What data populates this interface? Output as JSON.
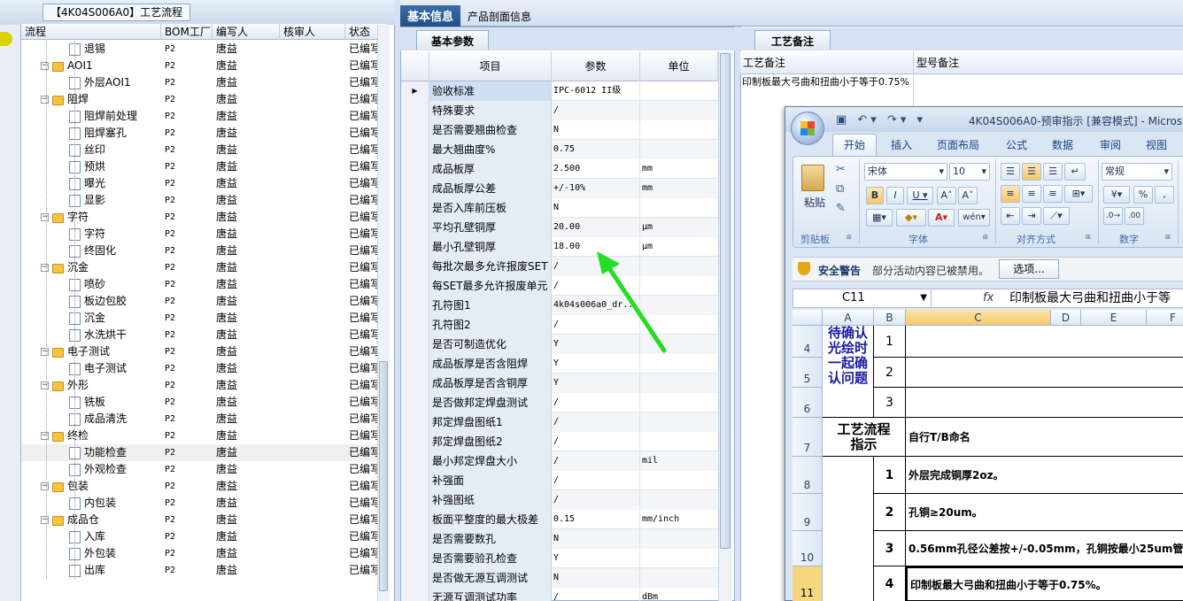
{
  "left_panel": {
    "title": "【4K04S006A0】工艺流程",
    "columns": [
      "流程",
      "BOM工厂",
      "编写人",
      "核审人",
      "状态"
    ],
    "rows": [
      {
        "name": "退锡",
        "type": "doc",
        "level": 1,
        "bom": "P2",
        "writer": "唐益",
        "status": "已编写"
      },
      {
        "name": "AOI1",
        "type": "folder",
        "level": 0,
        "bom": "P2",
        "writer": "唐益",
        "status": "已编写"
      },
      {
        "name": "外层AOI1",
        "type": "doc",
        "level": 1,
        "bom": "P2",
        "writer": "唐益",
        "status": "已编写"
      },
      {
        "name": "阻焊",
        "type": "folder",
        "level": 0,
        "bom": "P2",
        "writer": "唐益",
        "status": "已编写"
      },
      {
        "name": "阻焊前处理",
        "type": "doc",
        "level": 1,
        "bom": "P2",
        "writer": "唐益",
        "status": "已编写"
      },
      {
        "name": "阻焊塞孔",
        "type": "doc",
        "level": 1,
        "bom": "P2",
        "writer": "唐益",
        "status": "已编写"
      },
      {
        "name": "丝印",
        "type": "doc",
        "level": 1,
        "bom": "P2",
        "writer": "唐益",
        "status": "已编写"
      },
      {
        "name": "预烘",
        "type": "doc",
        "level": 1,
        "bom": "P2",
        "writer": "唐益",
        "status": "已编写"
      },
      {
        "name": "曝光",
        "type": "doc",
        "level": 1,
        "bom": "P2",
        "writer": "唐益",
        "status": "已编写"
      },
      {
        "name": "显影",
        "type": "doc",
        "level": 1,
        "bom": "P2",
        "writer": "唐益",
        "status": "已编写"
      },
      {
        "name": "字符",
        "type": "folder",
        "level": 0,
        "bom": "P2",
        "writer": "唐益",
        "status": "已编写"
      },
      {
        "name": "字符",
        "type": "doc",
        "level": 1,
        "bom": "P2",
        "writer": "唐益",
        "status": "已编写"
      },
      {
        "name": "终固化",
        "type": "doc",
        "level": 1,
        "bom": "P2",
        "writer": "唐益",
        "status": "已编写"
      },
      {
        "name": "沉金",
        "type": "folder",
        "level": 0,
        "bom": "P2",
        "writer": "唐益",
        "status": "已编写"
      },
      {
        "name": "喷砂",
        "type": "doc",
        "level": 1,
        "bom": "P2",
        "writer": "唐益",
        "status": "已编写"
      },
      {
        "name": "板边包胶",
        "type": "doc",
        "level": 1,
        "bom": "P2",
        "writer": "唐益",
        "status": "已编写"
      },
      {
        "name": "沉金",
        "type": "doc",
        "level": 1,
        "bom": "P2",
        "writer": "唐益",
        "status": "已编写"
      },
      {
        "name": "水洗烘干",
        "type": "doc",
        "level": 1,
        "bom": "P2",
        "writer": "唐益",
        "status": "已编写"
      },
      {
        "name": "电子测试",
        "type": "folder",
        "level": 0,
        "bom": "P2",
        "writer": "唐益",
        "status": "已编写"
      },
      {
        "name": "电子测试",
        "type": "doc",
        "level": 1,
        "bom": "P2",
        "writer": "唐益",
        "status": "已编写"
      },
      {
        "name": "外形",
        "type": "folder",
        "level": 0,
        "bom": "P2",
        "writer": "唐益",
        "status": "已编写"
      },
      {
        "name": "铣板",
        "type": "doc",
        "level": 1,
        "bom": "P2",
        "writer": "唐益",
        "status": "已编写"
      },
      {
        "name": "成品清洗",
        "type": "doc",
        "level": 1,
        "bom": "P2",
        "writer": "唐益",
        "status": "已编写"
      },
      {
        "name": "终检",
        "type": "folder",
        "level": 0,
        "bom": "P2",
        "writer": "唐益",
        "status": "已编写"
      },
      {
        "name": "功能检查",
        "type": "doc",
        "level": 1,
        "bom": "P2",
        "writer": "唐益",
        "status": "已编写",
        "selected": true
      },
      {
        "name": "外观检查",
        "type": "doc",
        "level": 1,
        "bom": "P2",
        "writer": "唐益",
        "status": "已编写"
      },
      {
        "name": "包装",
        "type": "folder",
        "level": 0,
        "bom": "P2",
        "writer": "唐益",
        "status": "已编写"
      },
      {
        "name": "内包装",
        "type": "doc",
        "level": 1,
        "bom": "P2",
        "writer": "唐益",
        "status": "已编写"
      },
      {
        "name": "成品仓",
        "type": "folder",
        "level": 0,
        "bom": "P2",
        "writer": "唐益",
        "status": "已编写"
      },
      {
        "name": "入库",
        "type": "doc",
        "level": 1,
        "bom": "P2",
        "writer": "唐益",
        "status": "已编写"
      },
      {
        "name": "外包装",
        "type": "doc",
        "level": 1,
        "bom": "P2",
        "writer": "唐益",
        "status": "已编写"
      },
      {
        "name": "出库",
        "type": "doc",
        "level": 1,
        "bom": "P2",
        "writer": "唐益",
        "status": "已编写"
      }
    ]
  },
  "top_tabs": {
    "active": "基本信息",
    "other": "产品剖面信息"
  },
  "basic_params": {
    "tab": "基本参数",
    "columns": [
      "项目",
      "参数",
      "单位"
    ],
    "rows": [
      {
        "item": "验收标准",
        "value": "IPC-6012 II级",
        "unit": ""
      },
      {
        "item": "特殊要求",
        "value": "/",
        "unit": ""
      },
      {
        "item": "是否需要翘曲检查",
        "value": "N",
        "unit": ""
      },
      {
        "item": "最大翘曲度%",
        "value": "0.75",
        "unit": ""
      },
      {
        "item": "成品板厚",
        "value": "2.500",
        "unit": "mm"
      },
      {
        "item": "成品板厚公差",
        "value": "+/-10%",
        "unit": "mm"
      },
      {
        "item": "是否入库前压板",
        "value": "N",
        "unit": ""
      },
      {
        "item": "平均孔壁铜厚",
        "value": "20.00",
        "unit": "μm"
      },
      {
        "item": "最小孔壁铜厚",
        "value": "18.00",
        "unit": "μm"
      },
      {
        "item": "每批次最多允许报废SET",
        "value": "/",
        "unit": ""
      },
      {
        "item": "每SET最多允许报废单元",
        "value": "/",
        "unit": ""
      },
      {
        "item": "孔符图1",
        "value": "4k04s006a0_dr...",
        "unit": ""
      },
      {
        "item": "孔符图2",
        "value": "/",
        "unit": ""
      },
      {
        "item": "是否可制造优化",
        "value": "Y",
        "unit": ""
      },
      {
        "item": "成品板厚是否含阻焊",
        "value": "Y",
        "unit": ""
      },
      {
        "item": "成品板厚是否含铜厚",
        "value": "Y",
        "unit": ""
      },
      {
        "item": "是否做邦定焊盘测试",
        "value": "/",
        "unit": ""
      },
      {
        "item": "邦定焊盘图纸1",
        "value": "/",
        "unit": ""
      },
      {
        "item": "邦定焊盘图纸2",
        "value": "/",
        "unit": ""
      },
      {
        "item": "最小邦定焊盘大小",
        "value": "/",
        "unit": "mil"
      },
      {
        "item": "补强面",
        "value": "/",
        "unit": ""
      },
      {
        "item": "补强图纸",
        "value": "/",
        "unit": ""
      },
      {
        "item": "板面平整度的最大极差",
        "value": "0.15",
        "unit": "mm/inch"
      },
      {
        "item": "是否需要数孔",
        "value": "N",
        "unit": ""
      },
      {
        "item": "是否需要验孔检查",
        "value": "Y",
        "unit": ""
      },
      {
        "item": "是否做无源互调测试",
        "value": "N",
        "unit": ""
      },
      {
        "item": "无源互调测试功率",
        "value": "/",
        "unit": "dBm"
      }
    ]
  },
  "process_notes": {
    "tab": "工艺备注",
    "col1": "工艺备注",
    "col2": "型号备注",
    "note": "印制板最大弓曲和扭曲小于等于0.75%"
  },
  "excel": {
    "title": "4K04S006A0-预审指示 [兼容模式] - Micros",
    "tabs": [
      "开始",
      "插入",
      "页面布局",
      "公式",
      "数据",
      "审阅",
      "视图"
    ],
    "font_name": "宋体",
    "font_size": "10",
    "number_format": "常规",
    "groups": [
      "剪贴板",
      "字体",
      "对齐方式",
      "数字"
    ],
    "paste_label": "粘贴",
    "security_title": "安全警告",
    "security_text": "部分活动内容已被禁用。",
    "options_button": "选项...",
    "namebox": "C11",
    "fx": "fx",
    "formula": "印制板最大弓曲和扭曲小于等",
    "columns": [
      "A",
      "B",
      "C",
      "D",
      "E",
      "F"
    ],
    "row_numbers": [
      "4",
      "5",
      "6",
      "7",
      "8",
      "9",
      "10",
      "11"
    ],
    "cell_a_confirm": "待确认光绘时一起确认问题",
    "b_nums_top": [
      "1",
      "2",
      "3"
    ],
    "cell_a_process": "工艺流程指示",
    "cell_c7": "自行T/B命名",
    "b_nums_bottom": [
      "1",
      "2",
      "3",
      "4"
    ],
    "c_lines": [
      "外层完成铜厚2oz。",
      "孔铜≥20um。",
      "0.56mm孔径公差按+/-0.05mm，孔铜按最小25um管",
      "印制板最大弓曲和扭曲小于等于0.75%。"
    ]
  },
  "annotation": {
    "color": "#22dd22"
  }
}
